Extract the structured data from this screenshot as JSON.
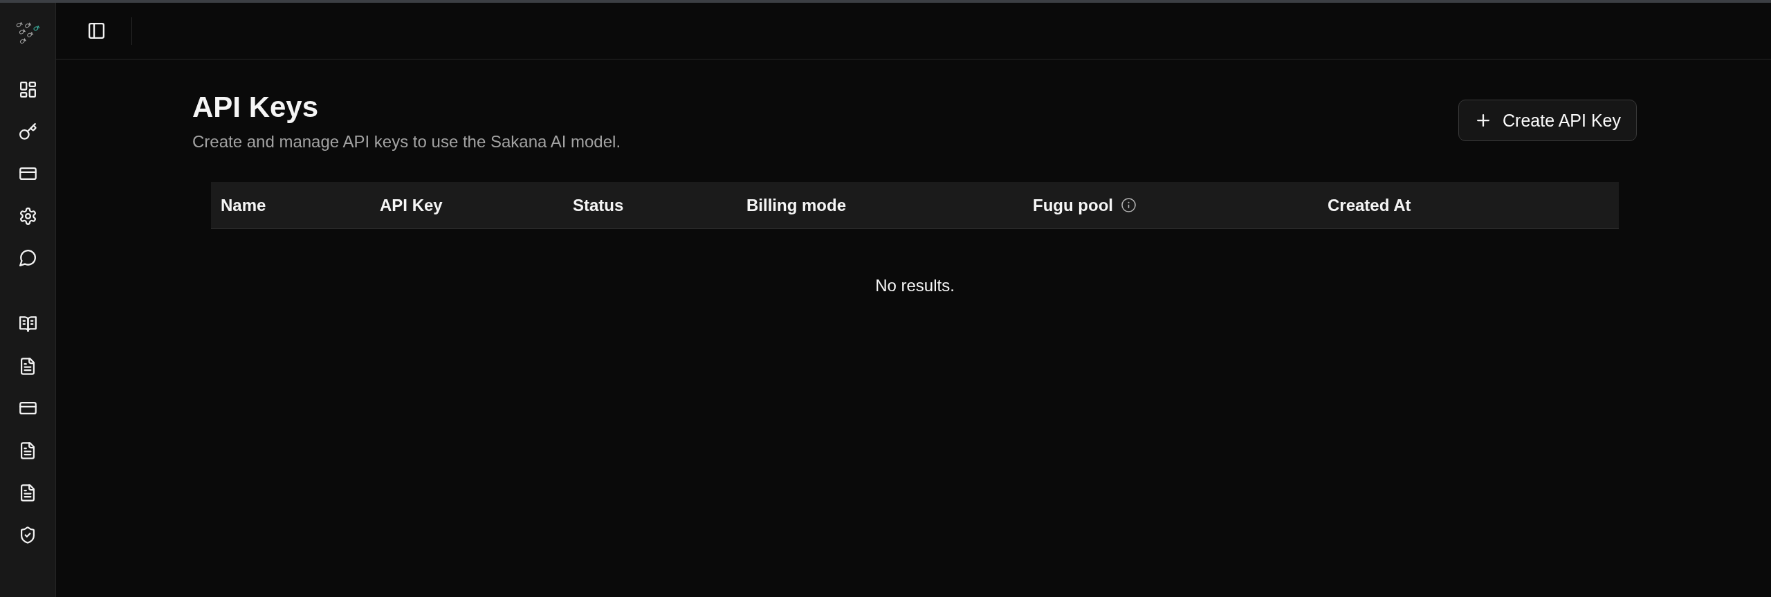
{
  "page_header": {
    "title": "API Keys",
    "subtitle": "Create and manage API keys to use the Sakana AI model."
  },
  "create_button": {
    "label": "Create API Key"
  },
  "table": {
    "columns": [
      {
        "label": "Name",
        "info": false
      },
      {
        "label": "API Key",
        "info": false
      },
      {
        "label": "Status",
        "info": false
      },
      {
        "label": "Billing mode",
        "info": false
      },
      {
        "label": "Fugu pool",
        "info": true
      },
      {
        "label": "Created At",
        "info": false
      }
    ],
    "empty_message": "No results."
  }
}
